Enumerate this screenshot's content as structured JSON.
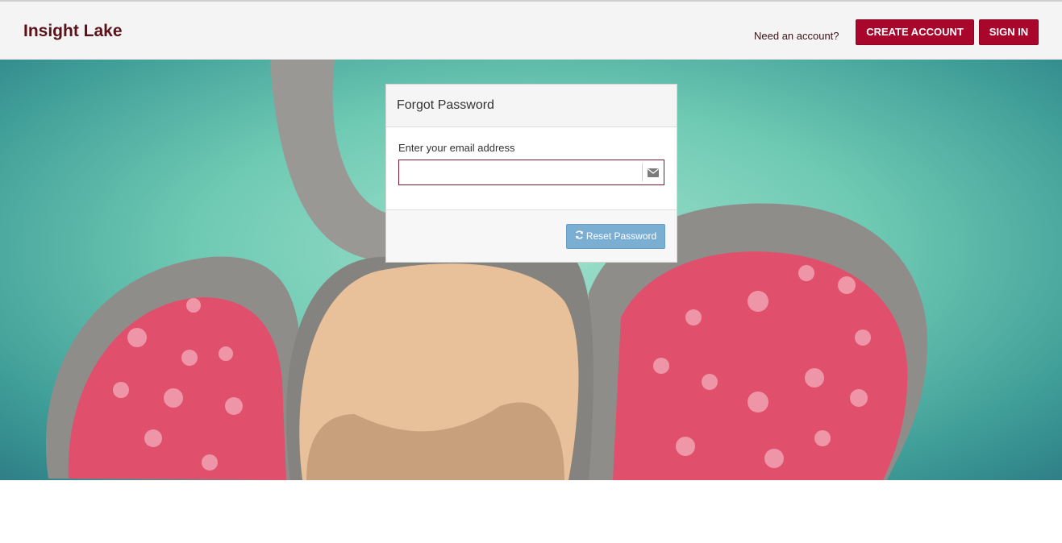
{
  "header": {
    "brand": "Insight Lake",
    "need_account": "Need an account?",
    "create_account_label": "CREATE ACCOUNT",
    "sign_in_label": "SIGN IN"
  },
  "forgot_panel": {
    "title": "Forgot Password",
    "email_label": "Enter your email address",
    "email_value": "",
    "email_icon": "envelope-icon",
    "reset_label": "Reset Password",
    "reset_icon": "refresh-icon"
  },
  "colors": {
    "brand_text": "#5a1119",
    "primary_button": "#a8072b",
    "reset_button": "#7aaed3",
    "input_border": "#7a1a33"
  }
}
